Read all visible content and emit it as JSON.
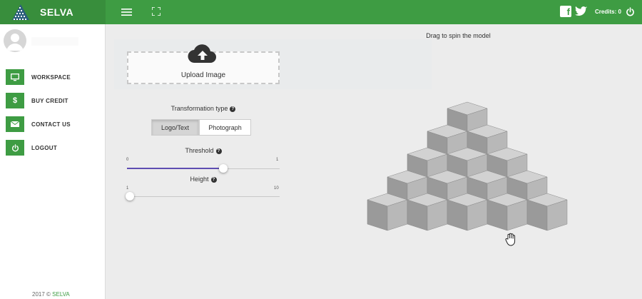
{
  "header": {
    "brand": "SELVA",
    "credits_text": "Credits: 0",
    "icons": [
      "logo-icon",
      "hamburger-menu-icon",
      "fullscreen-icon",
      "facebook-icon",
      "twitter-icon",
      "power-icon"
    ],
    "colors": {
      "primary": "#3e9c43",
      "brand_dark": "#388e3c"
    }
  },
  "sidebar": {
    "items": [
      {
        "label": "WORKSPACE",
        "icon": "monitor-icon"
      },
      {
        "label": "BUY CREDIT",
        "icon": "dollar-icon"
      },
      {
        "label": "CONTACT US",
        "icon": "mail-icon"
      },
      {
        "label": "LOGOUT",
        "icon": "power-icon"
      }
    ],
    "footer_prefix": "2017 © ",
    "footer_brand": "SELVA"
  },
  "main": {
    "upload_label": "Upload Image",
    "transformation_label": "Transformation type",
    "buttons": {
      "logo_text": "Logo/Text",
      "photograph": "Photograph"
    },
    "selected_type": "Logo/Text",
    "threshold": {
      "label": "Threshold",
      "min": "0",
      "max": "1",
      "value_fraction": 0.63
    },
    "height": {
      "label": "Height",
      "min": "1",
      "max": "10",
      "value_fraction": 0.0
    },
    "spin_hint": "Drag to spin the model"
  }
}
